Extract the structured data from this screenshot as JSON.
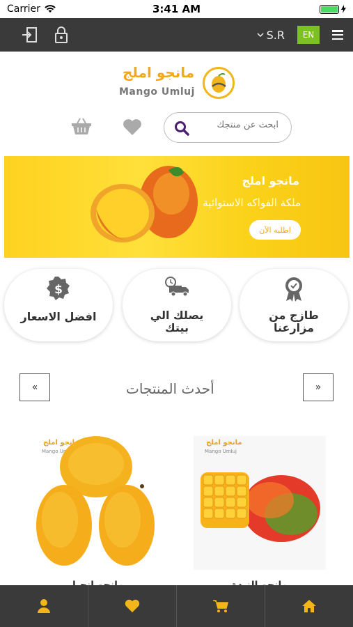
{
  "status": {
    "carrier": "Carrier",
    "time": "3:41 AM"
  },
  "header": {
    "currency": "S.R",
    "lang": "EN"
  },
  "logo": {
    "ar": "مانجو املج",
    "en": "Mango Umluj"
  },
  "search": {
    "placeholder": "ابحث عن منتجك"
  },
  "banner": {
    "title": "مانجو املج",
    "subtitle": "ملكة الفواكه الاستوائية",
    "cta": "اطلبه الآن"
  },
  "features": [
    {
      "label": "طازج من\nمزارعنا",
      "icon": "award-icon"
    },
    {
      "label": "يصلك الي\nبيتك",
      "icon": "delivery-truck-icon"
    },
    {
      "label": "افضل الاسعار",
      "icon": "dollar-badge-icon"
    }
  ],
  "section": {
    "title": "أحدث المنتجات",
    "prev": "«",
    "next": "»"
  },
  "products": [
    {
      "name": "مانجو النبدة",
      "logo_ar": "مانجو املج",
      "logo_en": "Mango Umluj"
    },
    {
      "name": "مانجو انجيا",
      "logo_ar": "مانجو املج",
      "logo_en": "Mango Umluj"
    }
  ],
  "tabs": [
    "home-icon",
    "cart-icon",
    "heart-icon",
    "user-icon"
  ],
  "colors": {
    "accent": "#7cc122",
    "brand": "#f2a818",
    "bar": "#3a3a3a",
    "icon_gold": "#f2b61a"
  }
}
